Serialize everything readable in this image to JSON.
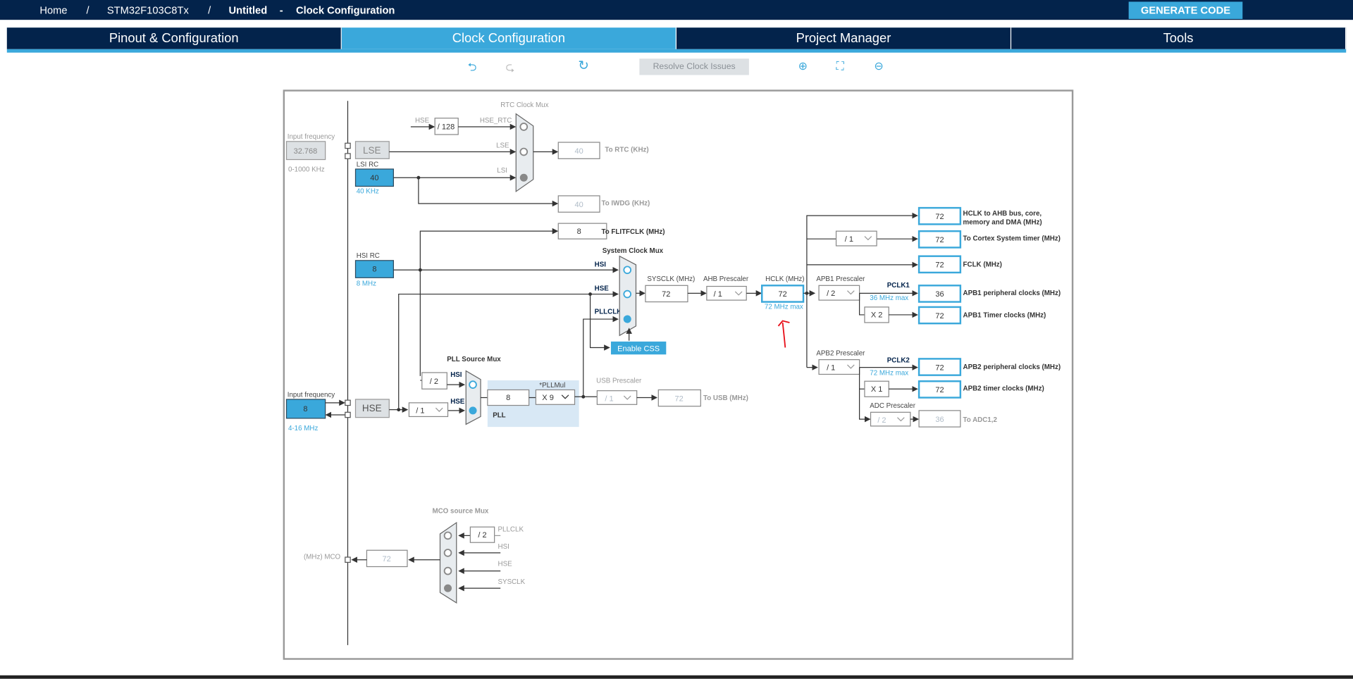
{
  "breadcrumb": {
    "home": "Home",
    "sep": "/",
    "chip": "STM32F103C8Tx",
    "project": "Untitled",
    "dash": "-",
    "page": "Clock Configuration"
  },
  "generate_label": "GENERATE CODE",
  "tabs": [
    {
      "label": "Pinout & Configuration"
    },
    {
      "label": "Clock Configuration",
      "active": true
    },
    {
      "label": "Project Manager"
    },
    {
      "label": "Tools"
    }
  ],
  "toolbar": {
    "undo": "undo-icon",
    "redo": "redo-icon",
    "refresh": "refresh-icon",
    "resolve": "Resolve Clock Issues",
    "zoom_in": "zoom-in-icon",
    "fit": "fit-icon",
    "zoom_out": "zoom-out-icon"
  },
  "colors": {
    "navy": "#03234b",
    "accent": "#3aa8db"
  },
  "diagram": {
    "lse": {
      "input_label": "Input frequency",
      "value": "32.768",
      "range": "0-1000 KHz",
      "name": "LSE"
    },
    "lsi": {
      "label": "LSI RC",
      "value": "40",
      "unit": "40 KHz"
    },
    "rtc": {
      "title": "RTC Clock Mux",
      "hse": "HSE",
      "div": "/ 128",
      "hse_rtc": "HSE_RTC",
      "lse": "LSE",
      "lsi": "LSI",
      "out": "40",
      "out_label": "To RTC (KHz)"
    },
    "iwdg": {
      "out": "40",
      "out_label": "To IWDG (KHz)"
    },
    "flit": {
      "out": "8",
      "out_label": "To FLITFCLK (MHz)"
    },
    "hsi": {
      "label": "HSI RC",
      "value": "8",
      "unit": "8 MHz"
    },
    "sysmux": {
      "title": "System Clock Mux",
      "hsi": "HSI",
      "hse": "HSE",
      "pll": "PLLCLK",
      "css": "Enable CSS"
    },
    "sysclk": {
      "label": "SYSCLK (MHz)",
      "value": "72"
    },
    "ahb": {
      "label": "AHB Prescaler",
      "value": "/ 1"
    },
    "hclk": {
      "label": "HCLK (MHz)",
      "value": "72",
      "max": "72 MHz max"
    },
    "outputs": {
      "ahb": {
        "value": "72",
        "label1": "HCLK to AHB bus, core,",
        "label2": "memory and DMA (MHz)"
      },
      "cortex": {
        "div": "/ 1",
        "value": "72",
        "label": "To Cortex System timer (MHz)"
      },
      "fclk": {
        "value": "72",
        "label": "FCLK (MHz)"
      },
      "apb1": {
        "prescaler_label": "APB1 Prescaler",
        "prescaler": "/ 2",
        "pclk": "PCLK1",
        "max": "36 MHz max",
        "value": "36",
        "label": "APB1 peripheral clocks (MHz)",
        "mult": "X 2",
        "timer": "72",
        "timer_label": "APB1 Timer clocks (MHz)"
      },
      "apb2": {
        "prescaler_label": "APB2 Prescaler",
        "prescaler": "/ 1",
        "pclk": "PCLK2",
        "max": "72 MHz max",
        "value": "72",
        "label": "APB2 peripheral clocks (MHz)",
        "mult": "X 1",
        "timer": "72",
        "timer_label": "APB2 timer clocks (MHz)"
      },
      "adc": {
        "prescaler_label": "ADC Prescaler",
        "prescaler": "/ 2",
        "value": "36",
        "label": "To ADC1,2"
      }
    },
    "pllsrc": {
      "title": "PLL Source Mux",
      "div2": "/ 2",
      "hsi": "HSI",
      "hse": "HSE"
    },
    "hse": {
      "input_label": "Input frequency",
      "value": "8",
      "range": "4-16 MHz",
      "name": "HSE",
      "div": "/ 1"
    },
    "pll": {
      "mul_label": "*PLLMul",
      "value": "8",
      "mul": "X 9",
      "name": "PLL"
    },
    "usb": {
      "label": "USB Prescaler",
      "prescaler": "/ 1",
      "value": "72",
      "out_label": "To USB (MHz)"
    },
    "mco": {
      "title": "MCO source Mux",
      "div": "/ 2",
      "pll": "PLLCLK",
      "hsi": "HSI",
      "hse": "HSE",
      "sys": "SYSCLK",
      "value": "72",
      "label": "(MHz) MCO"
    }
  }
}
